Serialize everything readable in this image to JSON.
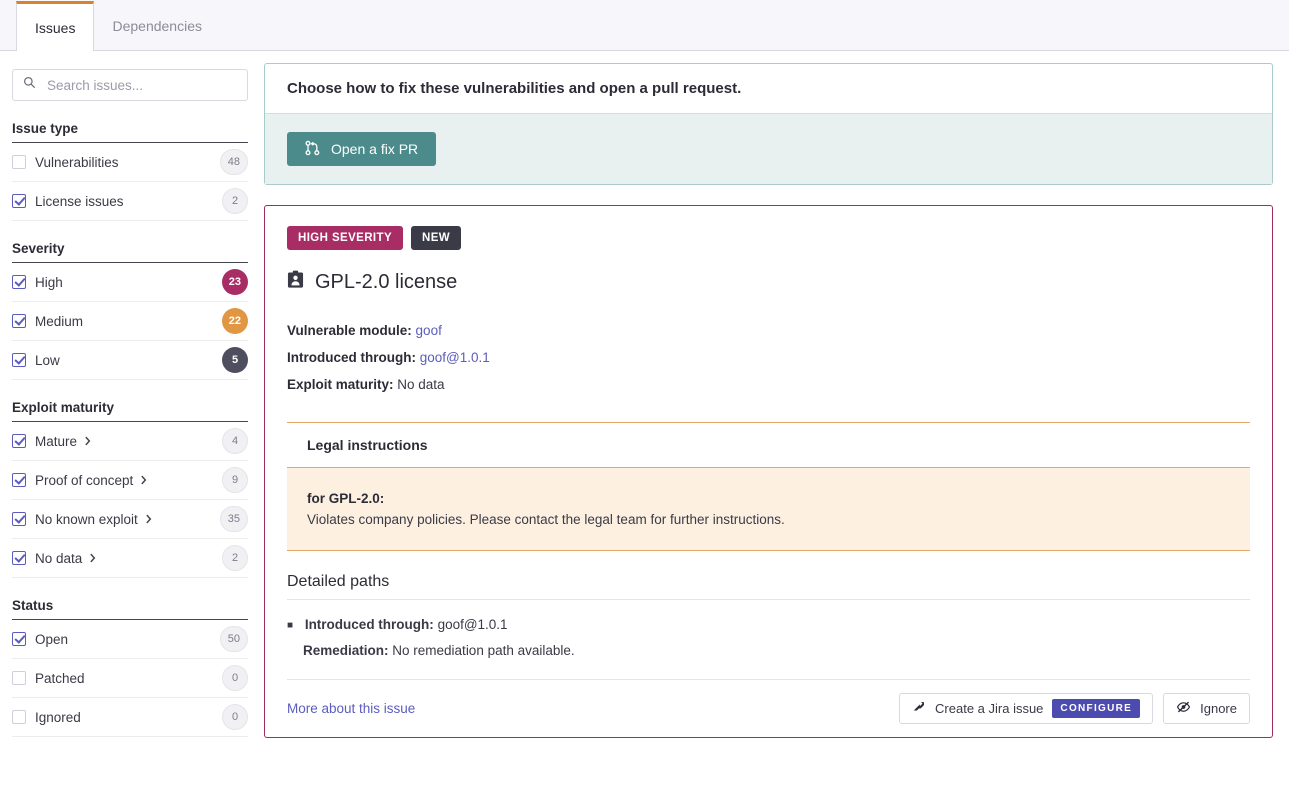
{
  "tabs": [
    {
      "label": "Issues",
      "active": true
    },
    {
      "label": "Dependencies",
      "active": false
    }
  ],
  "search": {
    "placeholder": "Search issues...",
    "value": "",
    "icon": "search-icon"
  },
  "filters": [
    {
      "title": "Issue type",
      "items": [
        {
          "label": "Vulnerabilities",
          "checked": false,
          "count": "48",
          "style": "plain",
          "chevron": false
        },
        {
          "label": "License issues",
          "checked": true,
          "count": "2",
          "style": "plain",
          "chevron": false
        }
      ]
    },
    {
      "title": "Severity",
      "items": [
        {
          "label": "High",
          "checked": true,
          "count": "23",
          "style": "sev",
          "color": "#a72d64",
          "chevron": false
        },
        {
          "label": "Medium",
          "checked": true,
          "count": "22",
          "style": "sev",
          "color": "#e09642",
          "chevron": false
        },
        {
          "label": "Low",
          "checked": true,
          "count": "5",
          "style": "sev",
          "color": "#4e4e5e",
          "chevron": false
        }
      ]
    },
    {
      "title": "Exploit maturity",
      "items": [
        {
          "label": "Mature",
          "checked": true,
          "count": "4",
          "style": "plain",
          "chevron": true
        },
        {
          "label": "Proof of concept",
          "checked": true,
          "count": "9",
          "style": "plain",
          "chevron": true
        },
        {
          "label": "No known exploit",
          "checked": true,
          "count": "35",
          "style": "plain",
          "chevron": true
        },
        {
          "label": "No data",
          "checked": true,
          "count": "2",
          "style": "plain",
          "chevron": true
        }
      ]
    },
    {
      "title": "Status",
      "items": [
        {
          "label": "Open",
          "checked": true,
          "count": "50",
          "style": "plain",
          "chevron": false
        },
        {
          "label": "Patched",
          "checked": false,
          "count": "0",
          "style": "plain",
          "chevron": false
        },
        {
          "label": "Ignored",
          "checked": false,
          "count": "0",
          "style": "plain",
          "chevron": false
        }
      ]
    }
  ],
  "fix_panel": {
    "heading": "Choose how to fix these vulnerabilities and open a pull request.",
    "button_label": "Open a fix PR",
    "button_icon": "pull-request-icon",
    "button_color": "#4b8b8b"
  },
  "issue": {
    "severity_badge": "HIGH SEVERITY",
    "new_badge": "NEW",
    "title": "GPL-2.0 license",
    "title_icon": "license-badge-icon",
    "border_color": "#9d2d63",
    "meta": [
      {
        "label": "Vulnerable module:",
        "value": "goof",
        "is_link": true
      },
      {
        "label": "Introduced through:",
        "value": "goof@1.0.1",
        "is_link": true
      },
      {
        "label": "Exploit maturity:",
        "value": "No data",
        "is_link": false
      }
    ],
    "legal": {
      "heading": "Legal instructions",
      "subject": "for GPL-2.0:",
      "text": "Violates company policies. Please contact the legal team for further instructions."
    },
    "paths": {
      "title": "Detailed paths",
      "introduced_label": "Introduced through:",
      "introduced_value": "goof@1.0.1",
      "remediation_label": "Remediation:",
      "remediation_value": "No remediation path available."
    },
    "footer": {
      "more_link": "More about this issue",
      "jira_label": "Create a Jira issue",
      "jira_icon": "jira-icon",
      "configure_label": "CONFIGURE",
      "ignore_label": "Ignore",
      "ignore_icon": "eye-slash-icon"
    }
  }
}
